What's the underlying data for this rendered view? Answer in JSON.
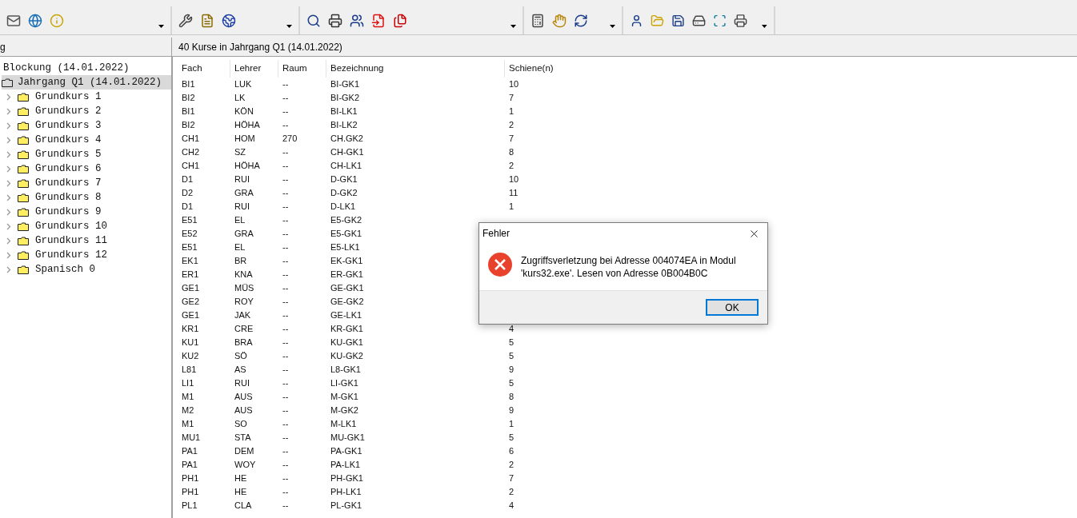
{
  "left_panel": {
    "title": "g",
    "tree": {
      "label": "Blockung (14.01.2022)",
      "children": [
        {
          "label": "Jahrgang Q1 (14.01.2022)",
          "selected": true,
          "children": [
            {
              "label": "Grundkurs 1",
              "selected": false
            },
            {
              "label": "Grundkurs 2",
              "selected": false
            },
            {
              "label": "Grundkurs 3",
              "selected": false
            },
            {
              "label": "Grundkurs 4",
              "selected": false
            },
            {
              "label": "Grundkurs 5",
              "selected": false
            },
            {
              "label": "Grundkurs 6",
              "selected": false
            },
            {
              "label": "Grundkurs 7",
              "selected": false
            },
            {
              "label": "Grundkurs 8",
              "selected": false
            },
            {
              "label": "Grundkurs 9",
              "selected": false
            },
            {
              "label": "Grundkurs 10",
              "selected": false
            },
            {
              "label": "Grundkurs 11",
              "selected": false
            },
            {
              "label": "Grundkurs 12",
              "selected": false
            },
            {
              "label": "Spanisch 0",
              "selected": false
            }
          ]
        }
      ]
    }
  },
  "right_panel": {
    "title": "40 Kurse in Jahrgang Q1 (14.01.2022)",
    "table": {
      "columns": [
        "Fach",
        "Lehrer",
        "Raum",
        "Bezeichnung",
        "Schiene(n)"
      ],
      "rows": [
        [
          "BI1",
          "LUK",
          "--",
          "BI-GK1",
          "10"
        ],
        [
          "BI2",
          "LK",
          "--",
          "BI-GK2",
          "7"
        ],
        [
          "BI1",
          "KÖN",
          "--",
          "BI-LK1",
          "1"
        ],
        [
          "BI2",
          "HÖHA",
          "--",
          "BI-LK2",
          "2"
        ],
        [
          "CH1",
          "HOM",
          "270",
          "CH.GK2",
          "7"
        ],
        [
          "CH2",
          "SZ",
          "--",
          "CH-GK1",
          "8"
        ],
        [
          "CH1",
          "HÖHA",
          "--",
          "CH-LK1",
          "2"
        ],
        [
          "D1",
          "RUI",
          "--",
          "D-GK1",
          "10"
        ],
        [
          "D2",
          "GRA",
          "--",
          "D-GK2",
          "11"
        ],
        [
          "D1",
          "RUI",
          "--",
          "D-LK1",
          "1"
        ],
        [
          "E51",
          "EL",
          "--",
          "E5-GK2"
        ],
        [
          "E52",
          "GRA",
          "--",
          "E5-GK1"
        ],
        [
          "E51",
          "EL",
          "--",
          "E5-LK1"
        ],
        [
          "EK1",
          "BR",
          "--",
          "EK-GK1"
        ],
        [
          "ER1",
          "KNA",
          "--",
          "ER-GK1"
        ],
        [
          "GE1",
          "MÜS",
          "--",
          "GE-GK1"
        ],
        [
          "GE2",
          "ROY",
          "--",
          "GE-GK2"
        ],
        [
          "GE1",
          "JAK",
          "--",
          "GE-LK1"
        ],
        [
          "KR1",
          "CRE",
          "--",
          "KR-GK1",
          "4"
        ],
        [
          "KU1",
          "BRA",
          "--",
          "KU-GK1",
          "5"
        ],
        [
          "KU2",
          "SÖ",
          "--",
          "KU-GK2",
          "5"
        ],
        [
          "L81",
          "AS",
          "--",
          "L8-GK1",
          "9"
        ],
        [
          "LI1",
          "RUI",
          "--",
          "LI-GK1",
          "5"
        ],
        [
          "M1",
          "AUS",
          "--",
          "M-GK1",
          "8"
        ],
        [
          "M2",
          "AUS",
          "--",
          "M-GK2",
          "9"
        ],
        [
          "M1",
          "SO",
          "--",
          "M-LK1",
          "1"
        ],
        [
          "MU1",
          "STA",
          "--",
          "MU-GK1",
          "5"
        ],
        [
          "PA1",
          "DEM",
          "--",
          "PA-GK1",
          "6"
        ],
        [
          "PA1",
          "WOY",
          "--",
          "PA-LK1",
          "2"
        ],
        [
          "PH1",
          "HE",
          "--",
          "PH-GK1",
          "7"
        ],
        [
          "PH1",
          "HE",
          "--",
          "PH-LK1",
          "2"
        ],
        [
          "PL1",
          "CLA",
          "--",
          "PL-GK1",
          "4"
        ]
      ]
    }
  },
  "dialog": {
    "title": "Fehler",
    "message": "Zugriffsverletzung bei Adresse 004074EA in Modul 'kurs32.exe'. Lesen von Adresse 0B004B0C",
    "buttons": [
      {
        "label": "OK",
        "selected": true
      }
    ]
  }
}
